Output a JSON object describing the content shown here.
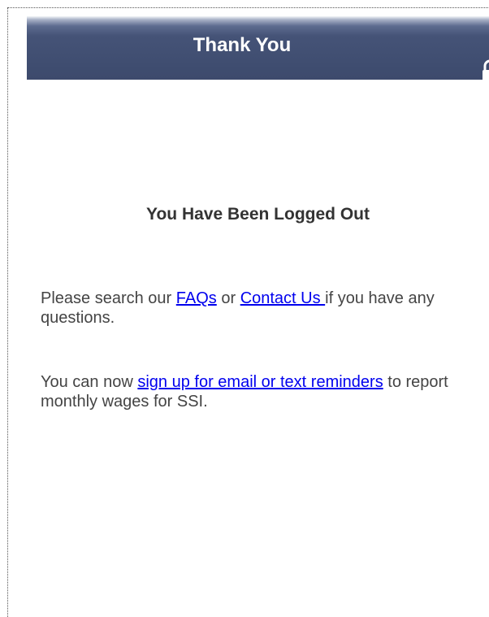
{
  "header": {
    "title": "Thank You",
    "lock_icon": "unlocked-padlock-icon",
    "colors": {
      "bar": "#3f4d70",
      "title_text": "#ffffff"
    }
  },
  "main": {
    "heading": "You Have Been Logged Out",
    "help_paragraph": {
      "prefix": "Please search our ",
      "faqs_link": "FAQs",
      "middle": " or ",
      "contact_link": "Contact Us ",
      "suffix": "if you have any questions."
    },
    "reminder_paragraph": {
      "prefix": "You can now ",
      "signup_link": "sign up for email or text reminders",
      "suffix": " to report monthly wages for SSI."
    },
    "colors": {
      "link": "#0000ee",
      "text": "#444444"
    }
  }
}
